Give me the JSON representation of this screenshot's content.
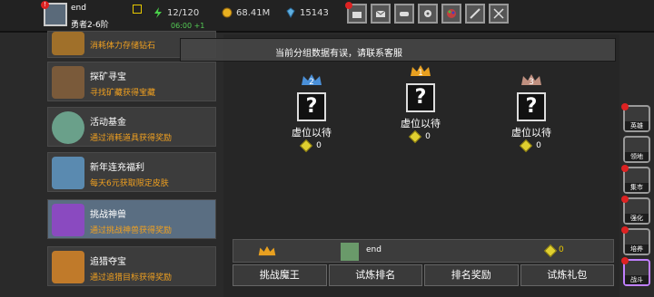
{
  "player": {
    "name": "end",
    "rank": "勇者2-6阶"
  },
  "stats": {
    "stamina": "12/120",
    "timer": "06:00 +1",
    "gold": "68.41M",
    "gems": "15143"
  },
  "toolbar": [
    "shop-icon",
    "mail-icon",
    "gamepad-icon",
    "gear-icon",
    "palette-icon",
    "sword-icon",
    "sword-2-icon"
  ],
  "tooltip": {
    "message": "当前分组数据有误，请联系客服"
  },
  "missions": [
    {
      "title": "",
      "desc": "消耗体力存储钻石",
      "color": "#a0702a"
    },
    {
      "title": "探矿寻宝",
      "desc": "寻找矿藏获得宝藏",
      "color": "#7a5a3a"
    },
    {
      "title": "活动基金",
      "desc": "通过消耗道具获得奖励",
      "color": "#6aa08a"
    },
    {
      "title": "新年连充福利",
      "desc": "每天6元获取限定皮肤",
      "color": "#5a8ab0"
    },
    {
      "title": "挑战神兽",
      "desc": "通过挑战神兽获得奖励",
      "color": "#8a4ac0"
    },
    {
      "title": "追猎夺宝",
      "desc": "通过追猎目标获得奖励",
      "color": "#c07a2a"
    }
  ],
  "ranking": [
    {
      "place": "2",
      "name": "虚位以待",
      "value": "0",
      "crown_color": "#4a90d9"
    },
    {
      "place": "1",
      "name": "虚位以待",
      "value": "0",
      "crown_color": "#e8a020"
    },
    {
      "place": "3",
      "name": "虚位以待",
      "value": "0",
      "crown_color": "#c09080"
    }
  ],
  "my_entry": {
    "name": "end",
    "value": "0"
  },
  "tabs": [
    "挑战魔王",
    "试炼排名",
    "排名奖励",
    "试炼礼包"
  ],
  "side_buttons": [
    "英雄",
    "领地",
    "集市",
    "强化",
    "培养",
    "战斗"
  ]
}
